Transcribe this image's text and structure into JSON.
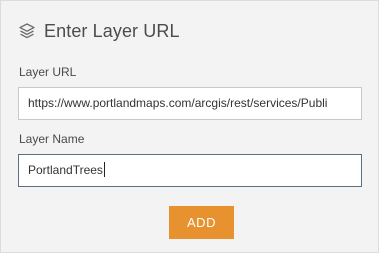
{
  "dialog": {
    "title": "Enter Layer URL",
    "icon": "layers-icon"
  },
  "layer_url": {
    "label": "Layer URL",
    "value": "https://www.portlandmaps.com/arcgis/rest/services/Publi"
  },
  "layer_name": {
    "label": "Layer Name",
    "value": "PortlandTrees"
  },
  "actions": {
    "add_label": "ADD"
  },
  "colors": {
    "panel_background": "#f3f3f3",
    "accent": "#e8912f",
    "focused_border": "#5a6f86"
  }
}
